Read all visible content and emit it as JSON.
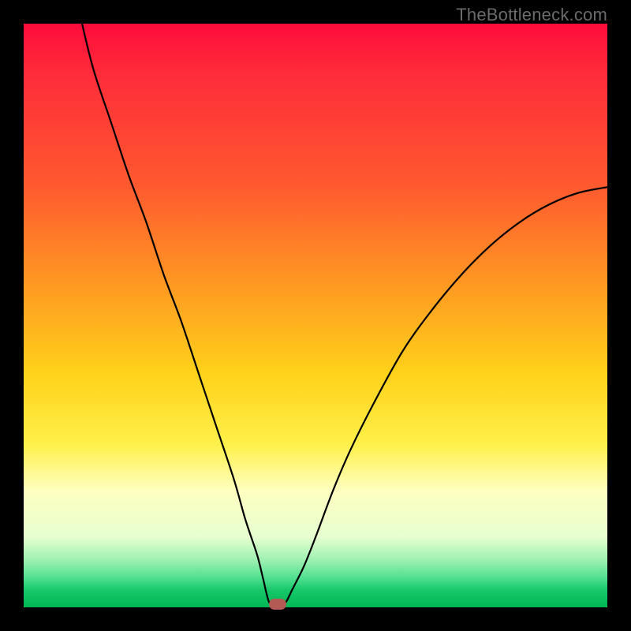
{
  "watermark": "TheBottleneck.com",
  "colors": {
    "curve": "#000000",
    "marker": "#b35a54"
  },
  "chart_data": {
    "type": "line",
    "title": "",
    "xlabel": "",
    "ylabel": "",
    "xlim": [
      0,
      100
    ],
    "ylim": [
      0,
      100
    ],
    "grid": false,
    "x": [
      10,
      12,
      15,
      18,
      21,
      24,
      27,
      30,
      33,
      36,
      38,
      40,
      41,
      42,
      43,
      44,
      45,
      46,
      48,
      50,
      53,
      56,
      60,
      65,
      70,
      75,
      80,
      85,
      90,
      95,
      100
    ],
    "values": [
      100,
      92,
      83,
      74,
      66,
      57,
      49,
      40,
      31,
      22,
      15,
      9,
      5,
      1,
      0,
      0,
      1,
      3,
      7,
      12,
      20,
      27,
      35,
      44,
      51,
      57,
      62,
      66,
      69,
      71,
      72
    ],
    "min_point": {
      "x": 43.5,
      "y": 0
    },
    "annotations": []
  }
}
